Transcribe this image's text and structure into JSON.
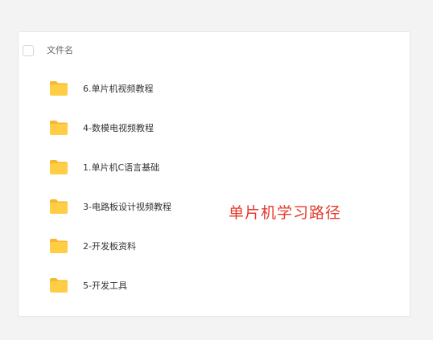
{
  "list": {
    "header": {
      "name_label": "文件名"
    },
    "items": [
      {
        "name": "6.单片机视频教程",
        "icon": "folder-icon"
      },
      {
        "name": "4-数模电视频教程",
        "icon": "folder-icon"
      },
      {
        "name": "1.单片机C语言基础",
        "icon": "folder-icon"
      },
      {
        "name": "3-电路板设计视频教程",
        "icon": "folder-icon"
      },
      {
        "name": "2-开发板资料",
        "icon": "folder-icon"
      },
      {
        "name": "5-开发工具",
        "icon": "folder-icon"
      }
    ]
  },
  "overlay": {
    "text": "单片机学习路径",
    "color": "#e53a2c"
  },
  "colors": {
    "folder_body": "#ffce45",
    "folder_back": "#f7b731",
    "background": "#f3f3f3"
  }
}
